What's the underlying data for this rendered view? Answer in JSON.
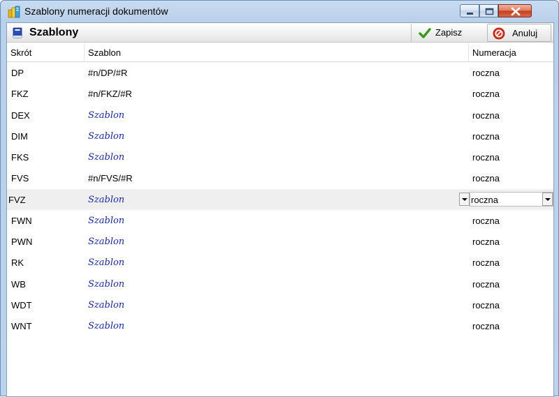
{
  "window": {
    "title": "Szablony numeracji dokumentów"
  },
  "toolbar": {
    "title": "Szablony",
    "save_label": "Zapisz",
    "cancel_label": "Anuluj"
  },
  "grid": {
    "columns": [
      "Skrót",
      "Szablon",
      "Numeracja"
    ],
    "rows": [
      {
        "code": "DP",
        "template": "#n/DP/#R",
        "placeholder": false,
        "numbering": "roczna"
      },
      {
        "code": "FKZ",
        "template": "#n/FKZ/#R",
        "placeholder": false,
        "numbering": "roczna"
      },
      {
        "code": "DEX",
        "template": "Szablon",
        "placeholder": true,
        "numbering": "roczna"
      },
      {
        "code": "DIM",
        "template": "Szablon",
        "placeholder": true,
        "numbering": "roczna"
      },
      {
        "code": "FKS",
        "template": "Szablon",
        "placeholder": true,
        "numbering": "roczna"
      },
      {
        "code": "FVS",
        "template": "#n/FVS/#R",
        "placeholder": false,
        "numbering": "roczna"
      },
      {
        "code": "FVZ",
        "template": "Szablon",
        "placeholder": true,
        "numbering": "roczna",
        "active": true
      },
      {
        "code": "FWN",
        "template": "Szablon",
        "placeholder": true,
        "numbering": "roczna"
      },
      {
        "code": "PWN",
        "template": "Szablon",
        "placeholder": true,
        "numbering": "roczna"
      },
      {
        "code": "RK",
        "template": "Szablon",
        "placeholder": true,
        "numbering": "roczna"
      },
      {
        "code": "WB",
        "template": "Szablon",
        "placeholder": true,
        "numbering": "roczna"
      },
      {
        "code": "WDT",
        "template": "Szablon",
        "placeholder": true,
        "numbering": "roczna"
      },
      {
        "code": "WNT",
        "template": "Szablon",
        "placeholder": true,
        "numbering": "roczna"
      }
    ]
  },
  "colors": {
    "placeholder_text": "#1a2aa0",
    "active_row": "#efefef",
    "save_check": "#3a9a1c",
    "cancel_icon": "#d8301c"
  }
}
